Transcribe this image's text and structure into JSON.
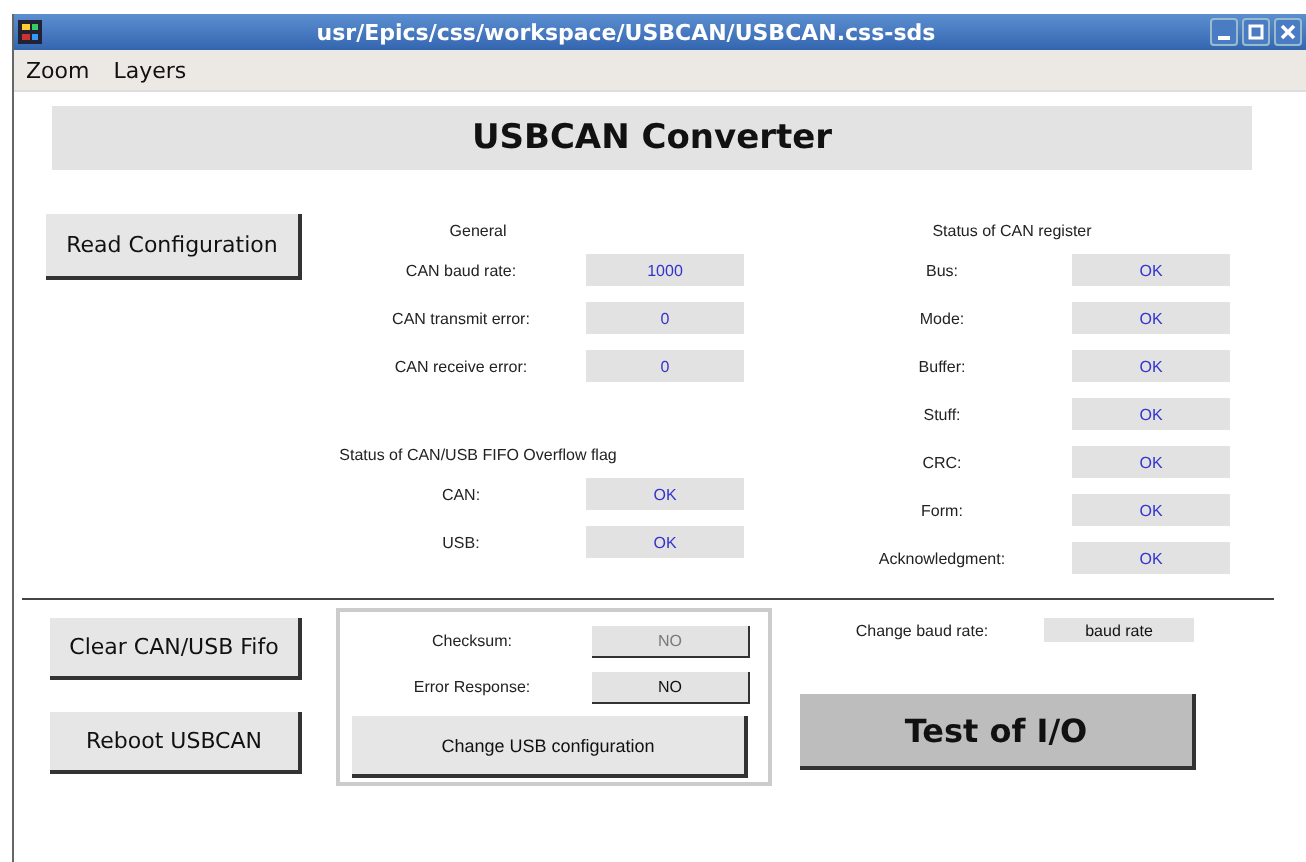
{
  "window": {
    "title": "usr/Epics/css/workspace/USBCAN/USBCAN.css-sds"
  },
  "menu": [
    "Zoom",
    "Layers"
  ],
  "banner": "USBCAN Converter",
  "read_button": "Read Configuration",
  "general": {
    "heading": "General",
    "rows": [
      {
        "label": "CAN baud rate:",
        "value": "1000"
      },
      {
        "label": "CAN transmit error:",
        "value": "0"
      },
      {
        "label": "CAN receive error:",
        "value": "0"
      }
    ]
  },
  "fifo": {
    "heading": "Status of CAN/USB FIFO Overflow flag",
    "rows": [
      {
        "label": "CAN:",
        "value": "OK"
      },
      {
        "label": "USB:",
        "value": "OK"
      }
    ]
  },
  "register": {
    "heading": "Status of CAN register",
    "rows": [
      {
        "label": "Bus:",
        "value": "OK"
      },
      {
        "label": "Mode:",
        "value": "OK"
      },
      {
        "label": "Buffer:",
        "value": "OK"
      },
      {
        "label": "Stuff:",
        "value": "OK"
      },
      {
        "label": "CRC:",
        "value": "OK"
      },
      {
        "label": "Form:",
        "value": "OK"
      },
      {
        "label": "Acknowledgment:",
        "value": "OK"
      }
    ]
  },
  "left_buttons": [
    "Clear CAN/USB Fifo",
    "Reboot USBCAN"
  ],
  "usb_config": {
    "options": [
      {
        "label": "Checksum:",
        "value": "NO",
        "disabled": true
      },
      {
        "label": "Error Response:",
        "value": "NO",
        "disabled": false
      }
    ],
    "button": "Change USB configuration"
  },
  "baud": {
    "label": "Change baud rate:",
    "value": "baud rate"
  },
  "test_button": "Test of I/O"
}
